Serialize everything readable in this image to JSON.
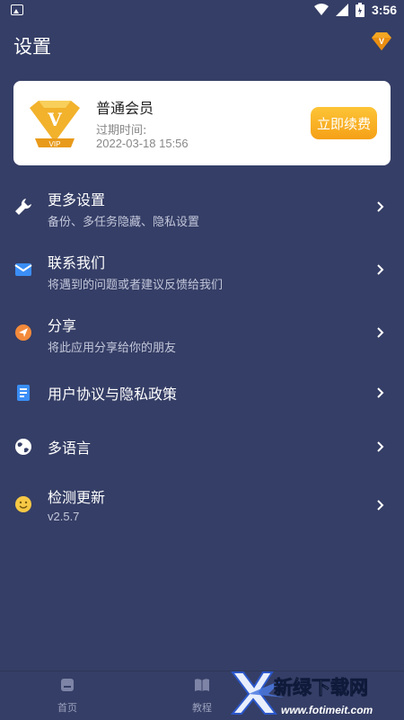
{
  "status_bar": {
    "time": "3:56"
  },
  "header": {
    "title": "设置"
  },
  "vip_card": {
    "membership": "普通会员",
    "expiry_label": "过期时间:",
    "expiry_date": "2022-03-18 15:56",
    "badge_text": "VIP",
    "renew_label": "立即续费"
  },
  "menu": [
    {
      "title": "更多设置",
      "subtitle": "备份、多任务隐藏、隐私设置",
      "icon": "wrench-icon"
    },
    {
      "title": "联系我们",
      "subtitle": "将遇到的问题或者建议反馈给我们",
      "icon": "mail-icon"
    },
    {
      "title": "分享",
      "subtitle": "将此应用分享给你的朋友",
      "icon": "share-icon"
    },
    {
      "title": "用户协议与隐私政策",
      "subtitle": "",
      "icon": "document-icon"
    },
    {
      "title": "多语言",
      "subtitle": "",
      "icon": "globe-icon"
    },
    {
      "title": "检测更新",
      "subtitle": "v2.5.7",
      "icon": "smiley-icon"
    }
  ],
  "bottom_nav": [
    {
      "label": "首页",
      "icon": "home-icon"
    },
    {
      "label": "教程",
      "icon": "book-icon"
    }
  ],
  "watermark": {
    "brand": "新绿下载网",
    "url": "www.fotimeit.com"
  },
  "colors": {
    "background": "#353e66",
    "card": "#ffffff",
    "accent_orange": "#f5a017",
    "gold": "#f2b22c"
  }
}
